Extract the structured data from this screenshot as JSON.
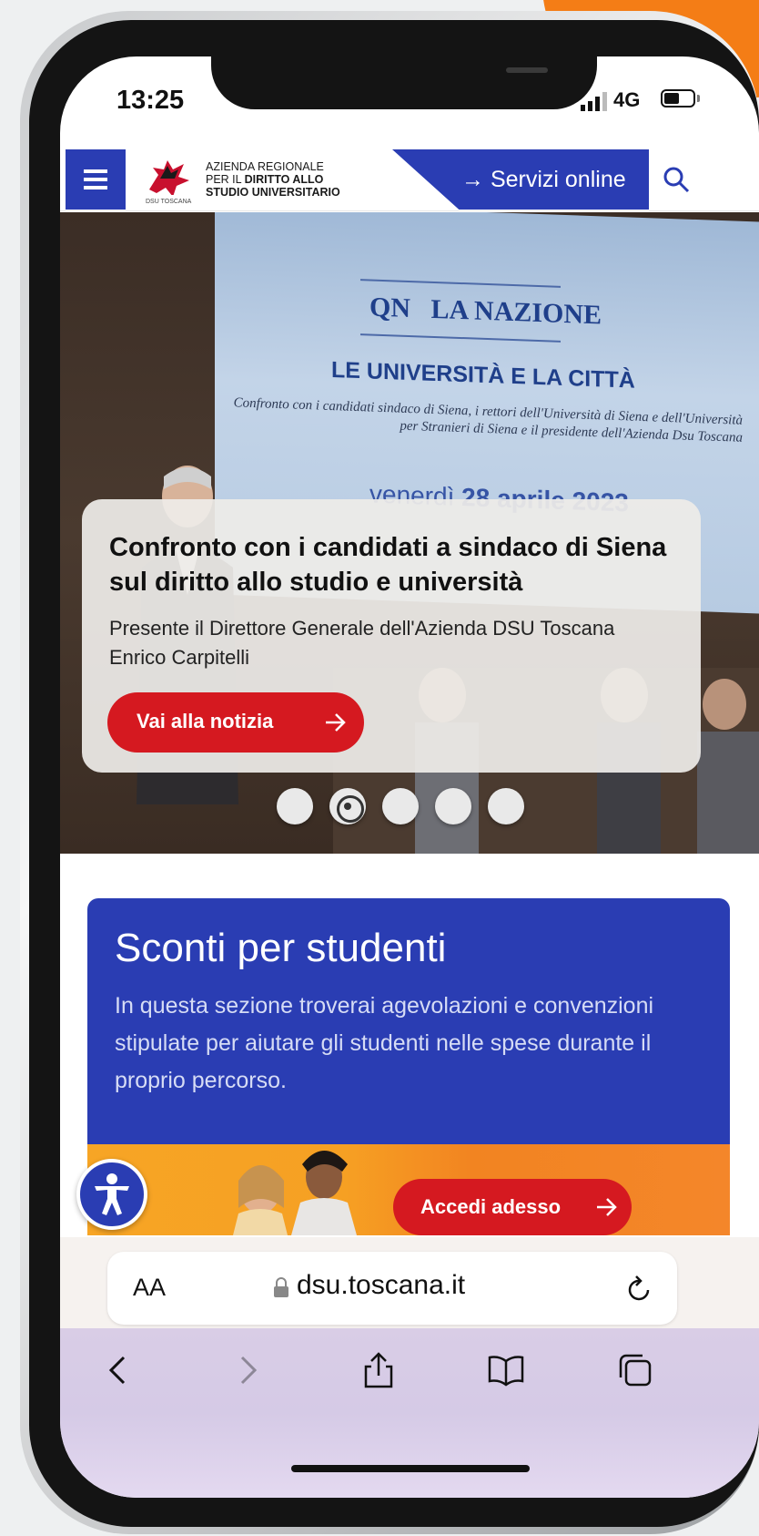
{
  "status_bar": {
    "time": "13:25",
    "network": "4G"
  },
  "header": {
    "menu_icon": "hamburger-icon",
    "logo_icon": "pegasus-logo",
    "logo_caption": "DSU TOSCANA",
    "logo_line1": "AZIENDA REGIONALE",
    "logo_line2_prefix": "PER IL ",
    "logo_line2_bold": "DIRITTO ALLO",
    "logo_line3": "STUDIO UNIVERSITARIO",
    "services_label": "→ Servizi online",
    "search_icon": "search-icon",
    "brand_color": "#2a3db3"
  },
  "hero": {
    "screen_logo": "QN",
    "screen_brand": "LA NAZIONE",
    "screen_headline": "LE UNIVERSITÀ E LA CITTÀ",
    "screen_sub": "Confronto con i candidati sindaco di Siena, i rettori dell'Università di Siena e dell'Università per Stranieri di Siena e il presidente dell'Azienda Dsu Toscana",
    "screen_date_prefix": "venerdì ",
    "screen_date_bold": "28 aprile 2023",
    "news_title": "Confronto con i candidati a sindaco di Siena sul diritto allo studio e università",
    "news_description": "Presente il Direttore Generale dell'Azienda DSU Toscana Enrico Carpitelli",
    "cta_label": "Vai alla notizia",
    "cta_color": "#d51920",
    "slides_total": 5,
    "active_slide": 2
  },
  "discounts": {
    "title": "Sconti per studenti",
    "description": "In questa sezione troverai agevolazioni e convenzioni stipulate per aiutare gli studenti nelle spese durante il proprio percorso.",
    "cta_label": "Accedi adesso"
  },
  "accessibility": {
    "icon": "accessibility-icon"
  },
  "browser": {
    "text_size_label": "AA",
    "url": "dsu.toscana.it",
    "reload_icon": "reload-icon",
    "toolbar_icons": [
      "back-icon",
      "forward-icon",
      "share-icon",
      "bookmarks-icon",
      "tabs-icon"
    ]
  }
}
